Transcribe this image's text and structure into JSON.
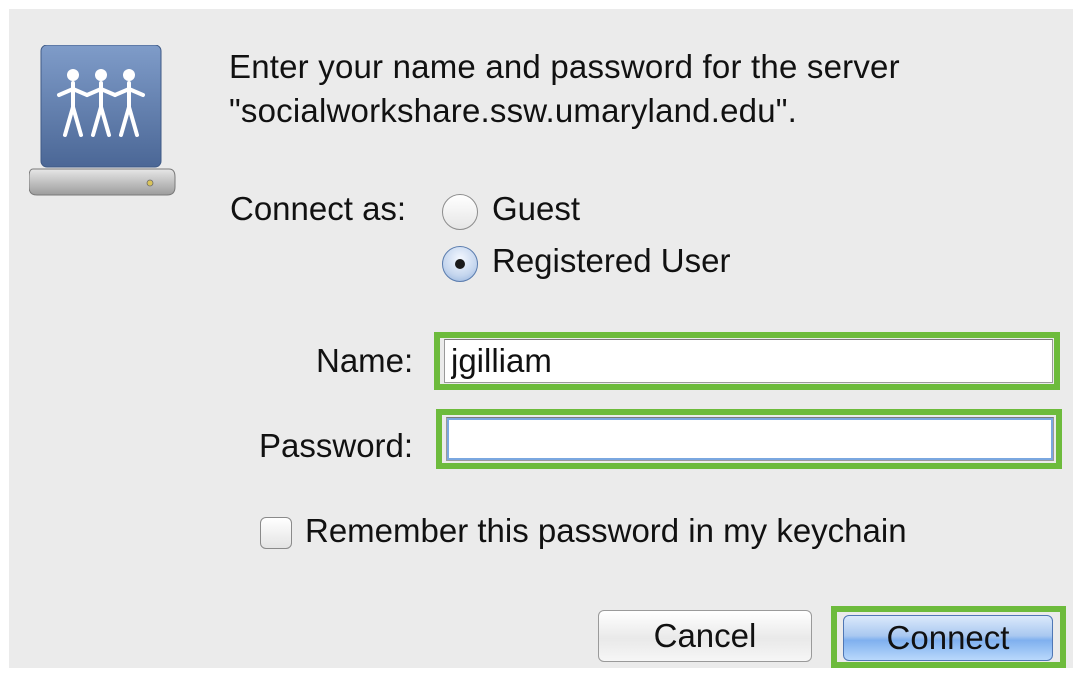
{
  "dialog": {
    "prompt_line1": "Enter your name and password for the server",
    "prompt_line2": "\"socialworkshare.ssw.umaryland.edu\".",
    "icon": "network-drive-icon",
    "connect_as_label": "Connect as:",
    "options": {
      "guest": "Guest",
      "registered": "Registered User",
      "selected": "Registered User"
    },
    "name_label": "Name:",
    "name_value": "jgilliam",
    "password_label": "Password:",
    "password_value": "",
    "remember_label": "Remember this password in my keychain",
    "remember_checked": false,
    "cancel_label": "Cancel",
    "connect_label": "Connect"
  },
  "colors": {
    "highlight": "#6dbb3c",
    "dialog_bg": "#ebebeb",
    "default_button": "#7fb0ef"
  }
}
